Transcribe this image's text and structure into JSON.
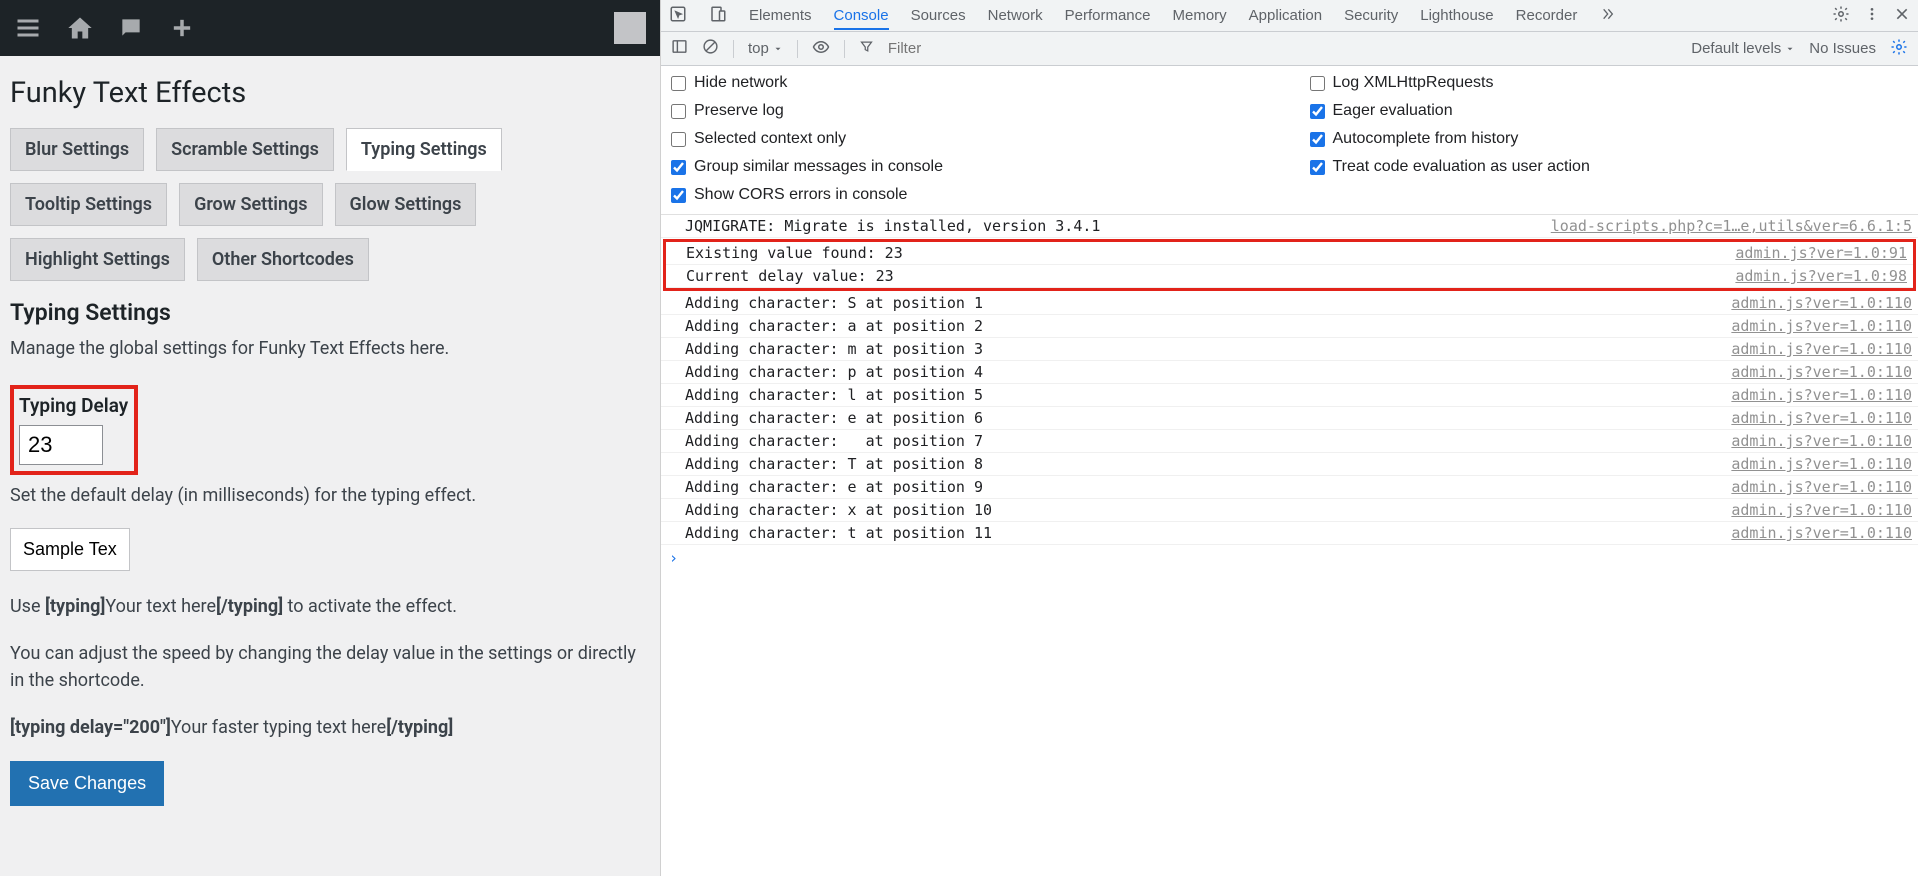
{
  "wp": {
    "page_title": "Funky Text Effects",
    "tabs": {
      "blur": "Blur Settings",
      "scramble": "Scramble Settings",
      "typing": "Typing Settings",
      "tooltip": "Tooltip Settings",
      "grow": "Grow Settings",
      "glow": "Glow Settings",
      "highlight": "Highlight Settings",
      "other": "Other Shortcodes"
    },
    "section_title": "Typing Settings",
    "section_desc": "Manage the global settings for Funky Text Effects here.",
    "field_label": "Typing Delay",
    "field_value": "23",
    "field_help": "Set the default delay (in milliseconds) for the typing effect.",
    "sample_value": "Sample Text",
    "usage_prefix": "Use ",
    "usage_open": "[typing]",
    "usage_mid": "Your text here",
    "usage_close": "[/typing]",
    "usage_suffix": " to activate the effect.",
    "adjust_text": "You can adjust the speed by changing the delay value in the settings or directly in the shortcode.",
    "example_open": "[typing delay=\"200\"]",
    "example_mid": "Your faster typing text here",
    "example_close": "[/typing]",
    "save_label": "Save Changes"
  },
  "devtools": {
    "tabs": {
      "elements": "Elements",
      "console": "Console",
      "sources": "Sources",
      "network": "Network",
      "performance": "Performance",
      "memory": "Memory",
      "application": "Application",
      "security": "Security",
      "lighthouse": "Lighthouse",
      "recorder": "Recorder"
    },
    "subbar": {
      "context": "top",
      "filter_placeholder": "Filter",
      "levels": "Default levels",
      "issues": "No Issues"
    },
    "settings": {
      "hide_network": "Hide network",
      "preserve_log": "Preserve log",
      "selected_context": "Selected context only",
      "group_similar": "Group similar messages in console",
      "show_cors": "Show CORS errors in console",
      "log_xhr": "Log XMLHttpRequests",
      "eager_eval": "Eager evaluation",
      "autocomplete": "Autocomplete from history",
      "user_action": "Treat code evaluation as user action"
    },
    "logs": {
      "jqmigrate": "JQMIGRATE: Migrate is installed, version 3.4.1",
      "jqmigrate_src": "load-scripts.php?c=1…e,utils&ver=6.6.1:5",
      "existing": "Existing value found: 23",
      "existing_src": "admin.js?ver=1.0:91",
      "current": "Current delay value: 23",
      "current_src": "admin.js?ver=1.0:98",
      "c0": "Adding character: S at position 1",
      "c1": "Adding character: a at position 2",
      "c2": "Adding character: m at position 3",
      "c3": "Adding character: p at position 4",
      "c4": "Adding character: l at position 5",
      "c5": "Adding character: e at position 6",
      "c6": "Adding character:   at position 7",
      "c7": "Adding character: T at position 8",
      "c8": "Adding character: e at position 9",
      "c9": "Adding character: x at position 10",
      "c10": "Adding character: t at position 11",
      "char_src": "admin.js?ver=1.0:110"
    }
  }
}
